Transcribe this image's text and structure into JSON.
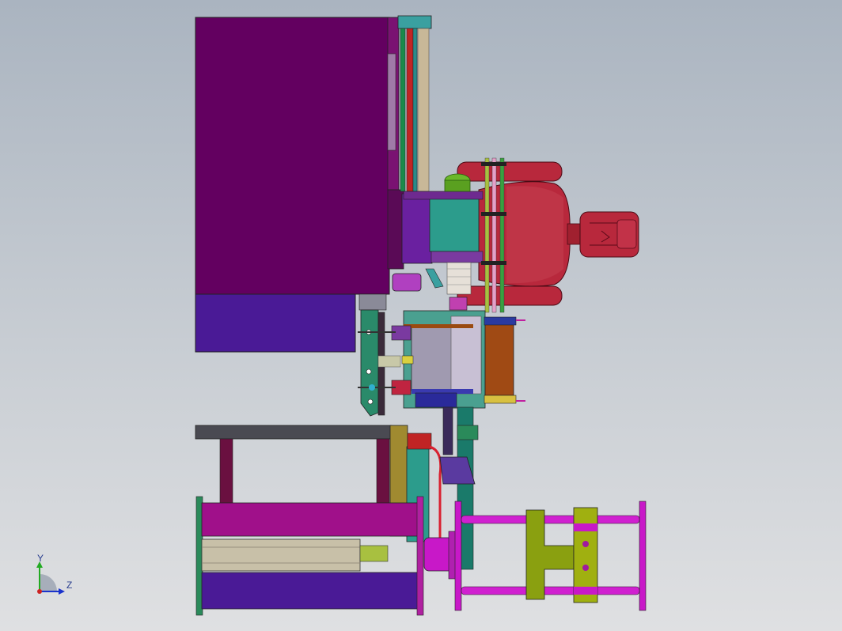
{
  "viewport": {
    "background_top": "#aab4c0",
    "background_bottom": "#dfe0e2"
  },
  "triad": {
    "y_label": "Y",
    "z_label": "Z",
    "y_color": "#22aa22",
    "z_color": "#1a33cc",
    "x_color": "#cc2222"
  },
  "colors": {
    "cabinet": "#630060",
    "cabinet_base": "#4a1a96",
    "robot": "#b8283c",
    "robot_dark": "#7a1024",
    "teal": "#2c9c8c",
    "magenta": "#c818c8",
    "purple": "#5a3aa0",
    "olive": "#8aa010",
    "brown": "#9a4a10",
    "frame": "#4a4a52",
    "tan": "#c8b898"
  }
}
